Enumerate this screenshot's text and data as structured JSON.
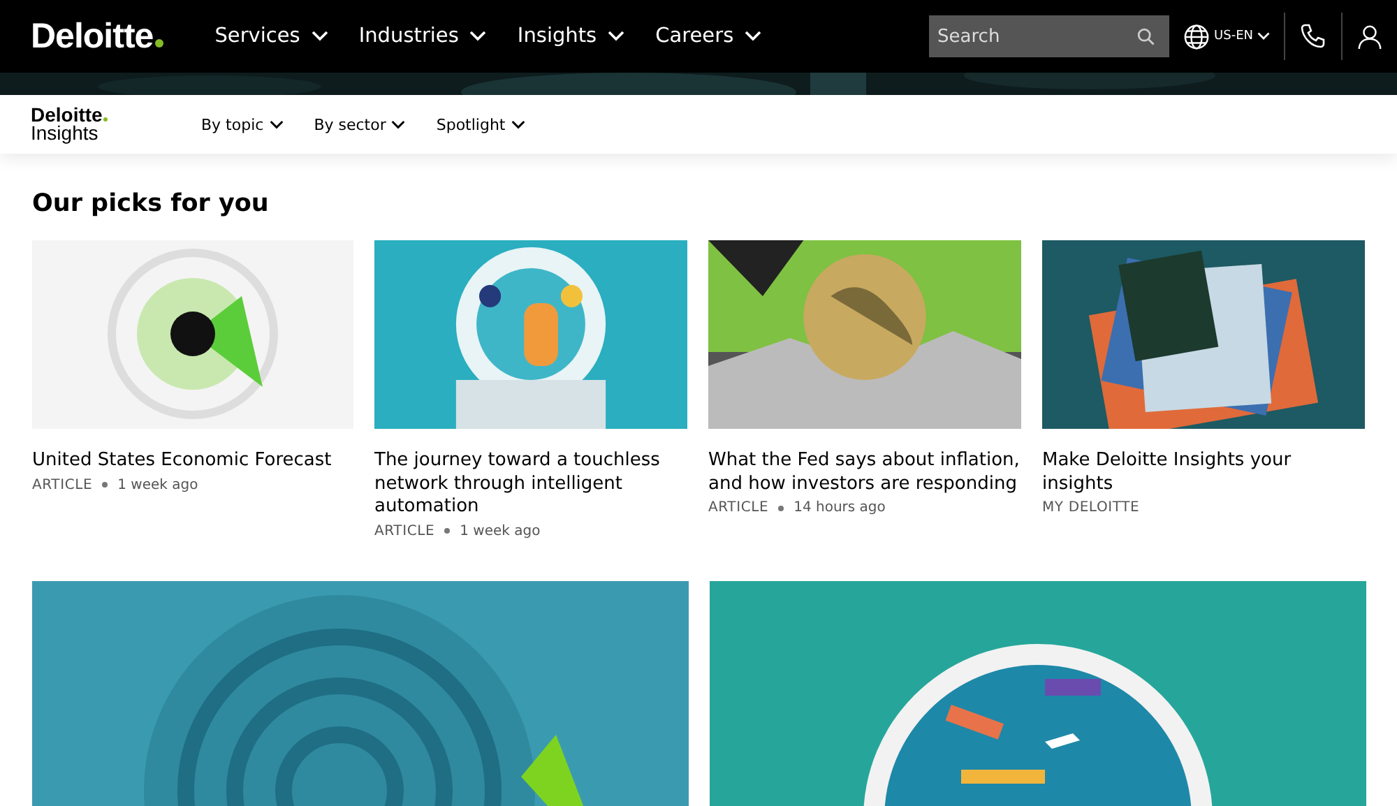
{
  "header": {
    "logo": "Deloitte",
    "nav": [
      {
        "label": "Services"
      },
      {
        "label": "Industries"
      },
      {
        "label": "Insights"
      },
      {
        "label": "Careers"
      }
    ],
    "search": {
      "placeholder": "Search"
    },
    "locale": "US-EN"
  },
  "subnav": {
    "logo_top": "Deloitte",
    "logo_bottom": "Insights",
    "items": [
      {
        "label": "By topic"
      },
      {
        "label": "By sector"
      },
      {
        "label": "Spotlight"
      }
    ]
  },
  "section": {
    "title": "Our picks for you"
  },
  "cards": [
    {
      "title": "United States Economic Forecast",
      "type": "ARTICLE",
      "time": "1 week ago"
    },
    {
      "title": "The journey toward a touchless network through intelligent automation",
      "type": "ARTICLE",
      "time": "1 week ago"
    },
    {
      "title": "What the Fed says about inflation, and how investors are responding",
      "type": "ARTICLE",
      "time": "14 hours ago"
    },
    {
      "title": "Make Deloitte Insights your insights",
      "type": "MY DELOITTE"
    }
  ]
}
